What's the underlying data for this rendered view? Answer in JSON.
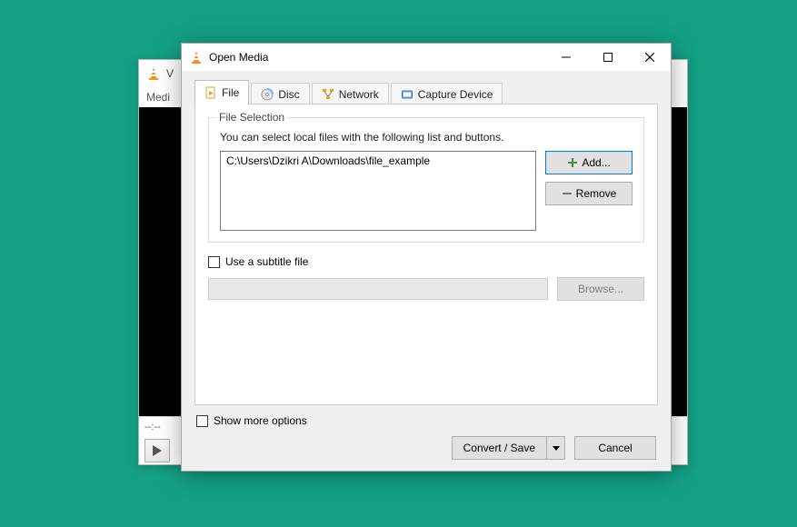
{
  "player": {
    "title_fragment": "V",
    "menu_fragment": "Medi",
    "status_time": "--:--"
  },
  "dialog": {
    "title": "Open Media",
    "tabs": {
      "file": "File",
      "disc": "Disc",
      "network": "Network",
      "capture": "Capture Device"
    },
    "file_selection": {
      "group_label": "File Selection",
      "hint": "You can select local files with the following list and buttons.",
      "entries": [
        "C:\\Users\\Dzikri A\\Downloads\\file_example"
      ],
      "add_label": "Add...",
      "remove_label": "Remove"
    },
    "subtitle": {
      "checkbox_label": "Use a subtitle file",
      "browse_label": "Browse..."
    },
    "show_more_label": "Show more options",
    "convert_label": "Convert / Save",
    "cancel_label": "Cancel"
  }
}
